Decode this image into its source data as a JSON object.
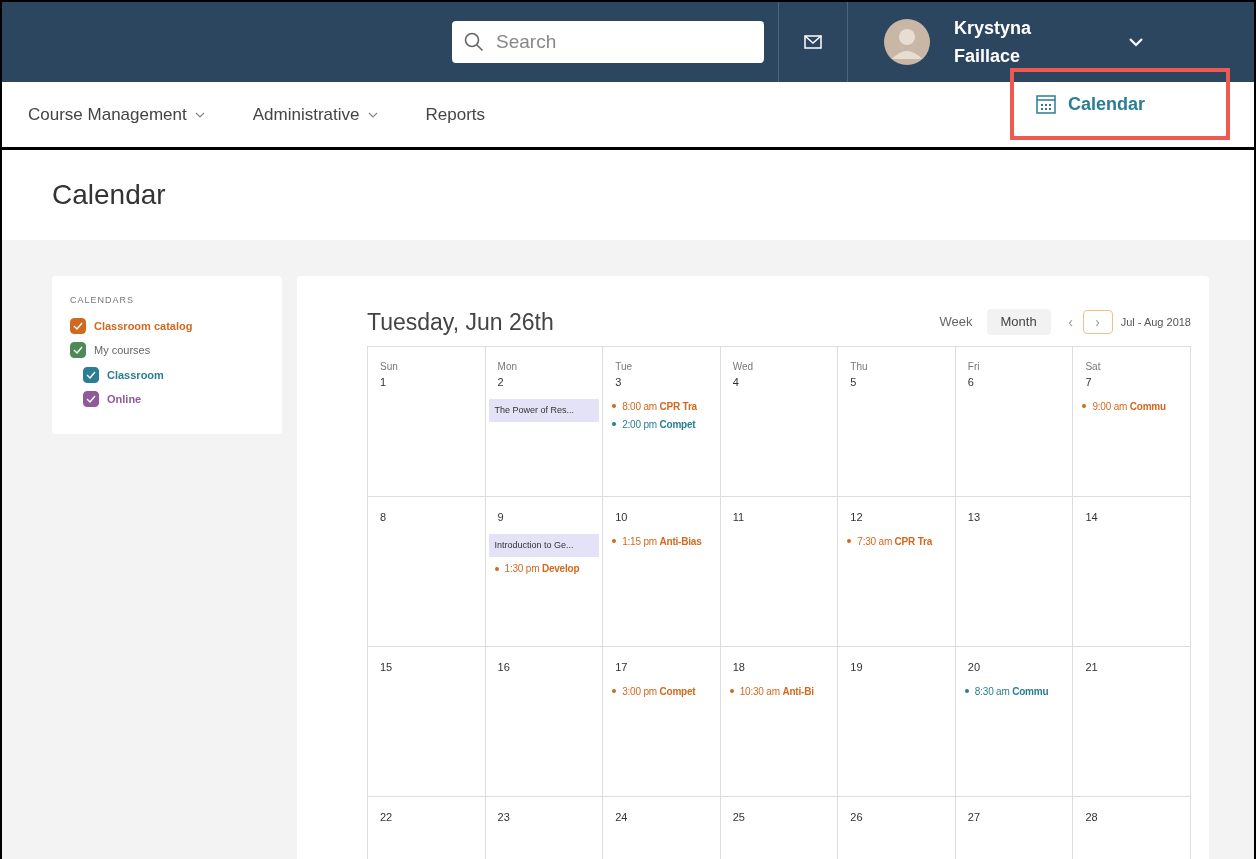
{
  "header": {
    "search": {
      "placeholder": "Search"
    },
    "user": {
      "name": "Krystyna Faillace"
    }
  },
  "nav": {
    "items": [
      {
        "label": "Course Management",
        "dropdown": true
      },
      {
        "label": "Administrative",
        "dropdown": true
      },
      {
        "label": "Reports",
        "dropdown": false
      }
    ],
    "calendar_link": {
      "label": "Calendar",
      "highlighted": true
    }
  },
  "page_title": "Calendar",
  "sidebar": {
    "heading": "CALENDARS",
    "items": [
      {
        "label": "Classroom catalog",
        "checked": true,
        "color": "#d2691e"
      },
      {
        "label": "My courses",
        "checked": true,
        "color": "#4e8a57",
        "children": [
          {
            "label": "Classroom",
            "checked": true,
            "color": "#2a7d93"
          },
          {
            "label": "Online",
            "checked": true,
            "color": "#8e5a9b"
          }
        ]
      }
    ]
  },
  "calendar": {
    "date_title": "Tuesday, Jun 26th",
    "views": [
      {
        "label": "Week",
        "selected": false
      },
      {
        "label": "Month",
        "selected": true
      }
    ],
    "prev": "‹",
    "next": "›",
    "range": "Jul - Aug 2018",
    "weeks": [
      [
        {
          "weekday": "Sun",
          "day": "1"
        },
        {
          "weekday": "Mon",
          "day": "2",
          "events": [
            {
              "kind": "block",
              "text": "The Power of Res..."
            }
          ]
        },
        {
          "weekday": "Tue",
          "day": "3",
          "events": [
            {
              "kind": "dot",
              "text": "8:00 am **CPR Tra**",
              "color": "#d2691e"
            },
            {
              "kind": "dot",
              "text": "2:00 pm **Compet**",
              "color": "#2a7d93"
            }
          ]
        },
        {
          "weekday": "Wed",
          "day": "4"
        },
        {
          "weekday": "Thu",
          "day": "5"
        },
        {
          "weekday": "Fri",
          "day": "6"
        },
        {
          "weekday": "Sat",
          "day": "7",
          "events": [
            {
              "kind": "dot",
              "text": "9:00 am **Commu**",
              "color": "#d2691e"
            }
          ]
        }
      ],
      [
        {
          "day": "8"
        },
        {
          "day": "9",
          "events": [
            {
              "kind": "block",
              "text": "Introduction to Ge..."
            },
            {
              "kind": "dot",
              "text": "1:30 pm **Develop**",
              "color": "#d2691e"
            }
          ]
        },
        {
          "day": "10",
          "events": [
            {
              "kind": "dot",
              "text": "1:15 pm **Anti-Bias**",
              "color": "#d2691e"
            }
          ]
        },
        {
          "day": "11"
        },
        {
          "day": "12",
          "events": [
            {
              "kind": "dot",
              "text": "7:30 am **CPR Tra**",
              "color": "#d2691e"
            }
          ]
        },
        {
          "day": "13"
        },
        {
          "day": "14"
        }
      ],
      [
        {
          "day": "15"
        },
        {
          "day": "16"
        },
        {
          "day": "17",
          "events": [
            {
              "kind": "dot",
              "text": "3:00 pm **Compet**",
              "color": "#d2691e"
            }
          ]
        },
        {
          "day": "18",
          "events": [
            {
              "kind": "dot",
              "text": "10:30 am **Anti-Bi**",
              "color": "#d2691e"
            }
          ]
        },
        {
          "day": "19"
        },
        {
          "day": "20",
          "events": [
            {
              "kind": "dot",
              "text": "8:30 am **Commu**",
              "color": "#2a7d93"
            }
          ]
        },
        {
          "day": "21"
        }
      ],
      [
        {
          "day": "22"
        },
        {
          "day": "23"
        },
        {
          "day": "24"
        },
        {
          "day": "25"
        },
        {
          "day": "26"
        },
        {
          "day": "27"
        },
        {
          "day": "28"
        }
      ]
    ]
  }
}
